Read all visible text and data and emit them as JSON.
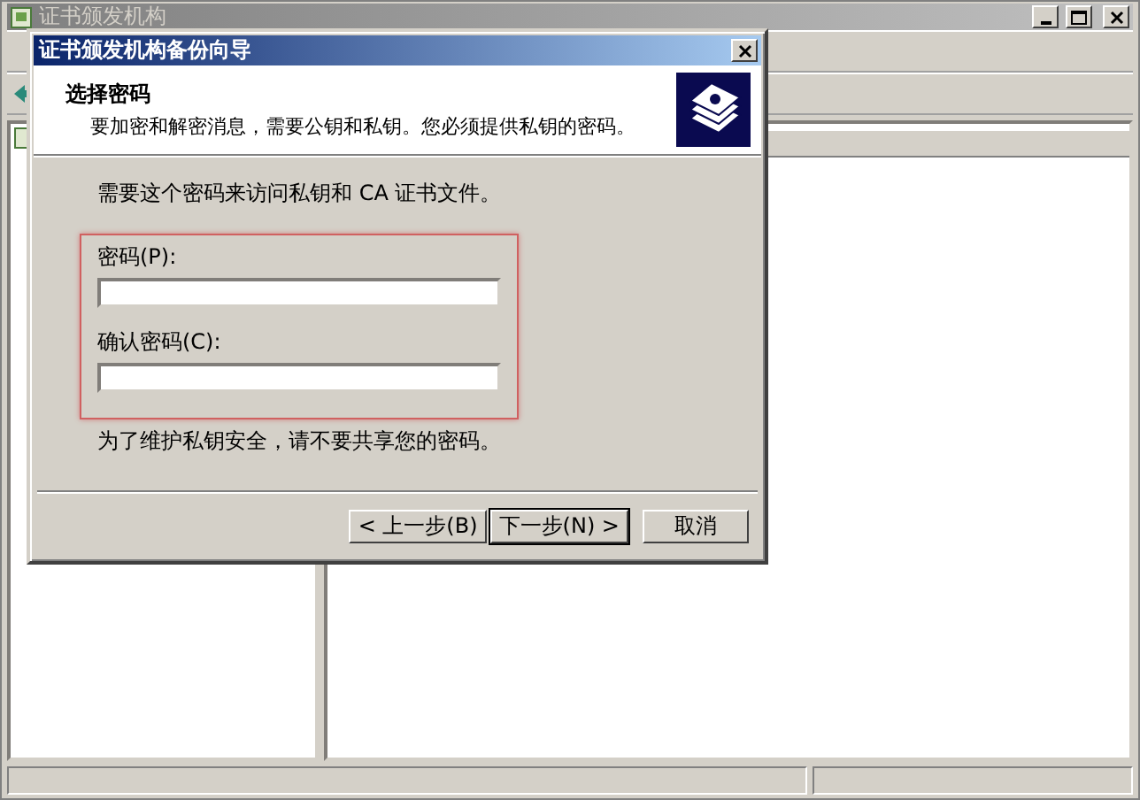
{
  "main_window": {
    "title": "证书颁发机构"
  },
  "dialog": {
    "title": "证书颁发机构备份向导",
    "header_title": "选择密码",
    "header_subtitle": "要加密和解密消息，需要公钥和私钥。您必须提供私钥的密码。",
    "intro": "需要这个密码来访问私钥和 CA 证书文件。",
    "fields": [
      {
        "label": "密码(P):"
      },
      {
        "label": "确认密码(C):"
      }
    ],
    "note": "为了维护私钥安全，请不要共享您的密码。",
    "buttons": [
      {
        "label": "< 上一步(B)",
        "default": false
      },
      {
        "label": "下一步(N) >",
        "default": true
      },
      {
        "label": "取消",
        "default": false
      }
    ]
  }
}
